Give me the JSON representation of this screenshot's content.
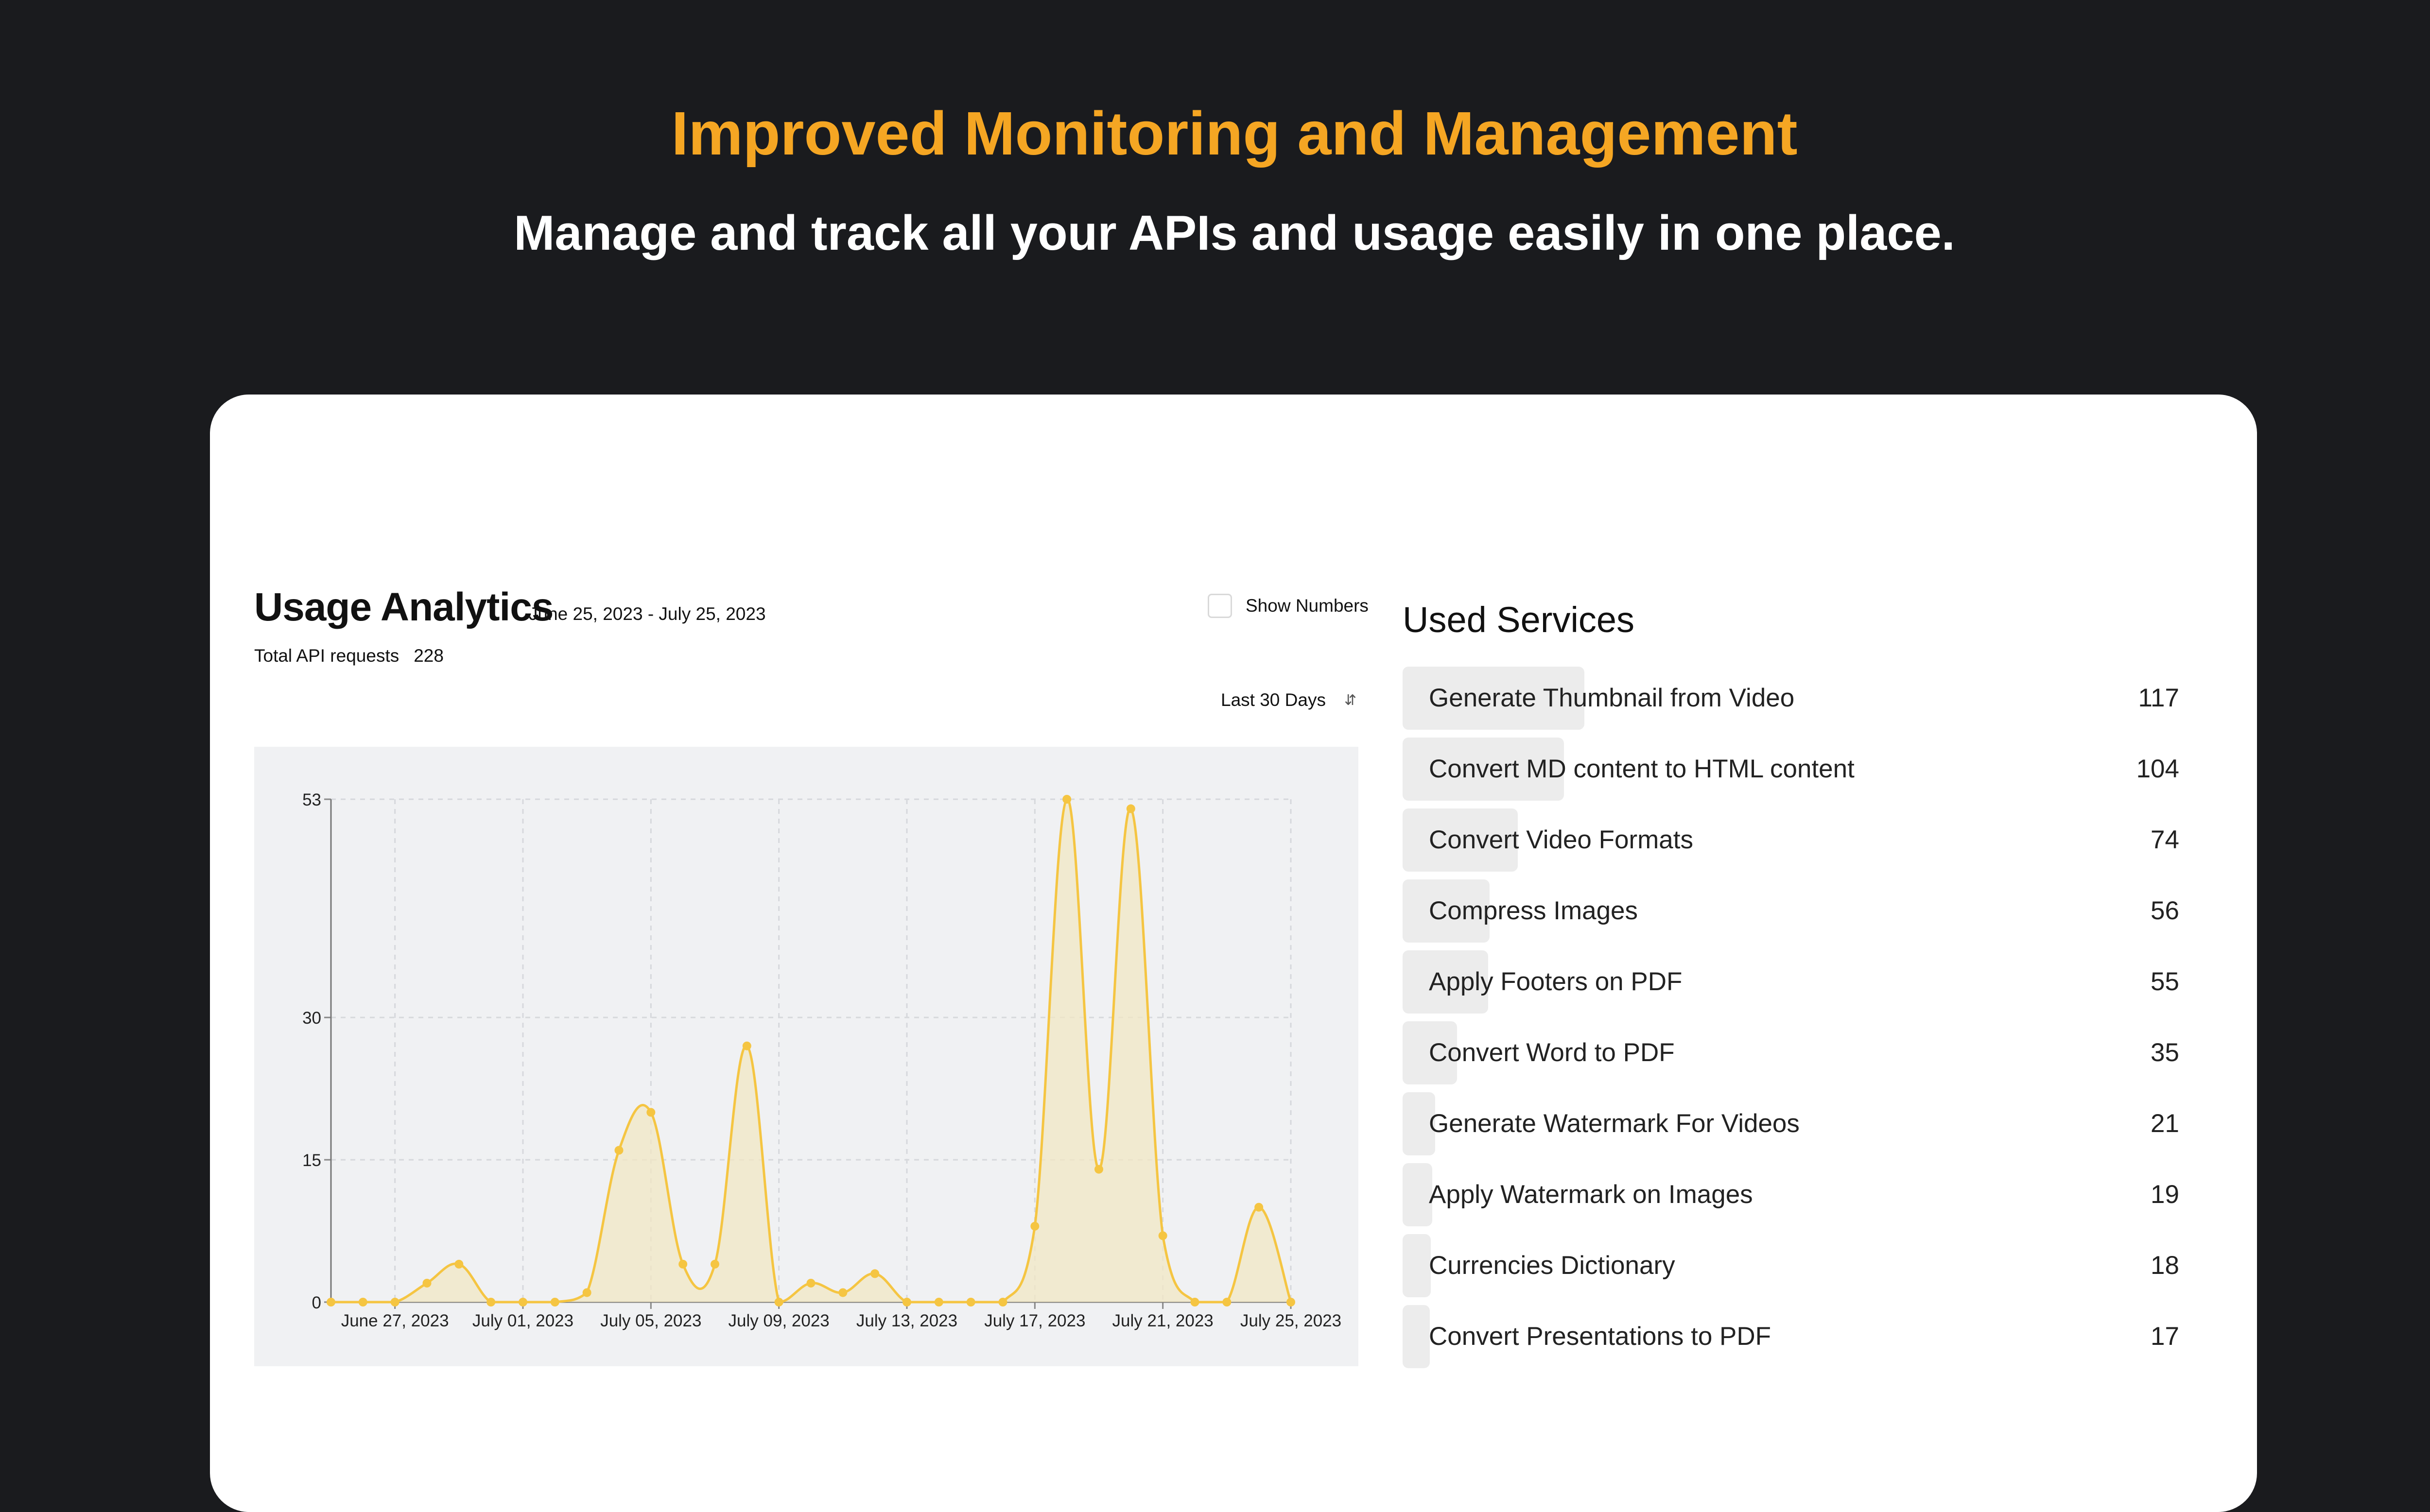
{
  "hero": {
    "title": "Improved Monitoring and Management",
    "subtitle": "Manage and track all your APIs and usage easily in one place."
  },
  "analytics": {
    "title": "Usage Analytics",
    "date_range": "June 25, 2023 - July 25, 2023",
    "total_label": "Total API requests",
    "total_value": "228",
    "show_numbers_label": "Show Numbers",
    "show_numbers_checked": false,
    "period_selected": "Last 30 Days"
  },
  "chart_data": {
    "type": "area",
    "title": "",
    "xlabel": "",
    "ylabel": "",
    "ylim": [
      0,
      53
    ],
    "yticks": [
      0,
      15,
      30,
      53
    ],
    "grid": true,
    "color": "#f5c542",
    "fill": "#f2e7c4",
    "x_tick_labels": [
      "June 27, 2023",
      "July 01, 2023",
      "July 05, 2023",
      "July 09, 2023",
      "July 13, 2023",
      "July 17, 2023",
      "July 21, 2023",
      "July 25, 2023"
    ],
    "x": [
      "June 25, 2023",
      "June 26, 2023",
      "June 27, 2023",
      "June 28, 2023",
      "June 29, 2023",
      "June 30, 2023",
      "July 01, 2023",
      "July 02, 2023",
      "July 03, 2023",
      "July 04, 2023",
      "July 05, 2023",
      "July 06, 2023",
      "July 07, 2023",
      "July 08, 2023",
      "July 09, 2023",
      "July 10, 2023",
      "July 11, 2023",
      "July 12, 2023",
      "July 13, 2023",
      "July 14, 2023",
      "July 15, 2023",
      "July 16, 2023",
      "July 17, 2023",
      "July 18, 2023",
      "July 19, 2023",
      "July 20, 2023",
      "July 21, 2023",
      "July 22, 2023",
      "July 23, 2023",
      "July 24, 2023",
      "July 25, 2023"
    ],
    "values": [
      0,
      0,
      0,
      2,
      4,
      0,
      0,
      0,
      1,
      16,
      20,
      4,
      4,
      27,
      0,
      2,
      1,
      3,
      0,
      0,
      0,
      0,
      8,
      53,
      14,
      52,
      7,
      0,
      0,
      10,
      0
    ]
  },
  "services": {
    "title": "Used Services",
    "max": 117,
    "items": [
      {
        "label": "Generate Thumbnail from Video",
        "count": 117
      },
      {
        "label": "Convert MD content to HTML content",
        "count": 104
      },
      {
        "label": "Convert Video Formats",
        "count": 74
      },
      {
        "label": "Compress Images",
        "count": 56
      },
      {
        "label": "Apply Footers on PDF",
        "count": 55
      },
      {
        "label": "Convert Word to PDF",
        "count": 35
      },
      {
        "label": "Generate Watermark For Videos",
        "count": 21
      },
      {
        "label": "Apply Watermark on Images",
        "count": 19
      },
      {
        "label": "Currencies Dictionary",
        "count": 18
      },
      {
        "label": "Convert Presentations to PDF",
        "count": 17
      }
    ]
  }
}
